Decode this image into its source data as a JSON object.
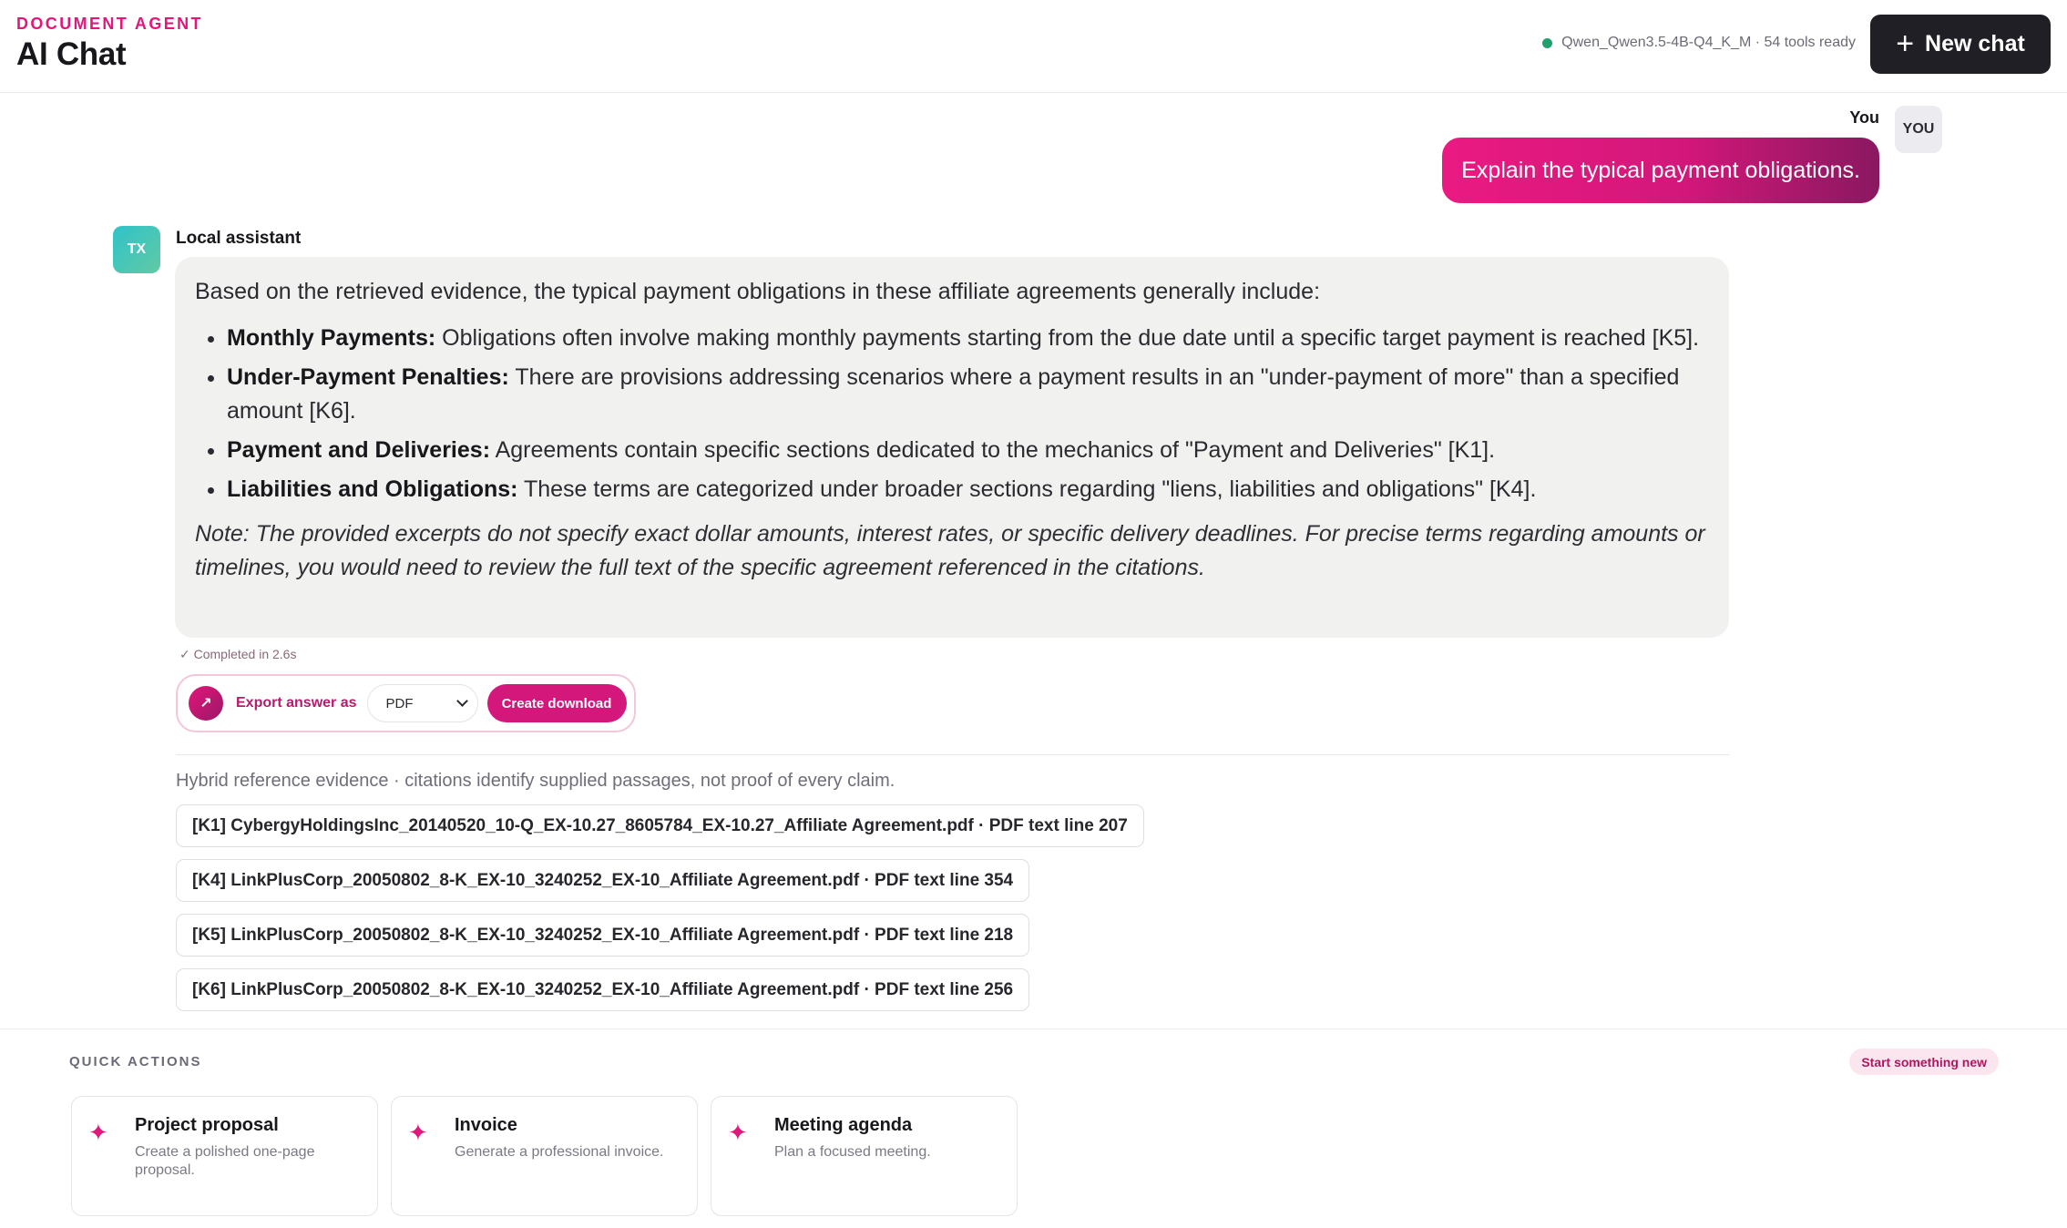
{
  "header": {
    "eyebrow": "DOCUMENT AGENT",
    "title": "AI Chat",
    "model_status": "Qwen_Qwen3.5-4B-Q4_K_M · 54 tools ready",
    "status_color": "#22a06b",
    "new_chat_label": "New chat",
    "new_chat_icon": "plus-icon"
  },
  "user_message": {
    "label": "You",
    "avatar": "YOU",
    "text": "Explain the typical payment obligations."
  },
  "assistant_message": {
    "label": "Local assistant",
    "avatar": "TX",
    "intro": "Based on the retrieved evidence, the typical payment obligations in these affiliate agreements generally include:",
    "items": [
      {
        "term": "Monthly Payments:",
        "text": " Obligations often involve making monthly payments starting from the due date until a specific target payment is reached [K5]."
      },
      {
        "term": "Under-Payment Penalties:",
        "text": " There are provisions addressing scenarios where a payment results in an \"under-payment of more\" than a specified amount [K6]."
      },
      {
        "term": "Payment and Deliveries:",
        "text": " Agreements contain specific sections dedicated to the mechanics of \"Payment and Deliveries\" [K1]."
      },
      {
        "term": "Liabilities and Obligations:",
        "text": " These terms are categorized under broader sections regarding \"liens, liabilities and obligations\" [K4]."
      }
    ],
    "note": "Note: The provided excerpts do not specify exact dollar amounts, interest rates, or specific delivery deadlines. For precise terms regarding amounts or timelines, you would need to review the full text of the specific agreement referenced in the citations.",
    "completed": "✓ Completed in 2.6s"
  },
  "export": {
    "label": "Export answer as",
    "icon": "arrow-up-right-icon",
    "format": "PDF",
    "button": "Create download"
  },
  "evidence": {
    "caption": "Hybrid reference evidence · citations identify supplied passages, not proof of every claim.",
    "citations": [
      "[K1] CybergyHoldingsInc_20140520_10-Q_EX-10.27_8605784_EX-10.27_Affiliate Agreement.pdf · PDF text line 207",
      "[K4] LinkPlusCorp_20050802_8-K_EX-10_3240252_EX-10_Affiliate Agreement.pdf · PDF text line 354",
      "[K5] LinkPlusCorp_20050802_8-K_EX-10_3240252_EX-10_Affiliate Agreement.pdf · PDF text line 218",
      "[K6] LinkPlusCorp_20050802_8-K_EX-10_3240252_EX-10_Affiliate Agreement.pdf · PDF text line 256"
    ]
  },
  "quick_actions": {
    "label": "QUICK ACTIONS",
    "start_new": "Start something new",
    "cards": [
      {
        "title": "Project proposal",
        "desc": "Create a polished one-page proposal.",
        "icon": "sparkle-icon"
      },
      {
        "title": "Invoice",
        "desc": "Generate a professional invoice.",
        "icon": "sparkle-icon"
      },
      {
        "title": "Meeting agenda",
        "desc": "Plan a focused meeting.",
        "icon": "sparkle-icon"
      }
    ]
  },
  "colors": {
    "accent": "#e2167b",
    "dark": "#1f1f25",
    "bubble_bg": "#f1f2ef"
  }
}
